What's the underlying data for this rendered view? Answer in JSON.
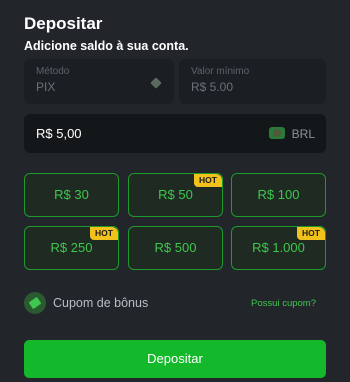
{
  "header": {
    "title": "Depositar",
    "subtitle": "Adicione saldo à sua conta."
  },
  "method": {
    "label": "Método",
    "value": "PIX",
    "icon": "pix-icon"
  },
  "minimum": {
    "label": "Valor mínimo",
    "value": "R$ 5.00"
  },
  "amount": {
    "value": "R$ 5,00",
    "currency": "BRL",
    "flag_icon": "brazil-flag-icon"
  },
  "presets": [
    {
      "label": "R$ 30",
      "hot": ""
    },
    {
      "label": "R$ 50",
      "hot": "HOT"
    },
    {
      "label": "R$ 100",
      "hot": ""
    },
    {
      "label": "R$ 250",
      "hot": "HOT"
    },
    {
      "label": "R$ 500",
      "hot": ""
    },
    {
      "label": "R$ 1.000",
      "hot": "HOT"
    }
  ],
  "coupon": {
    "icon": "ticket-icon",
    "label": "Cupom de bônus",
    "link": "Possui cupom?"
  },
  "submit_label": "Depositar",
  "colors": {
    "background": "#22262b",
    "accent": "#14b82b",
    "preset_text": "#3ec64e",
    "hot_badge": "#f1c21b"
  }
}
